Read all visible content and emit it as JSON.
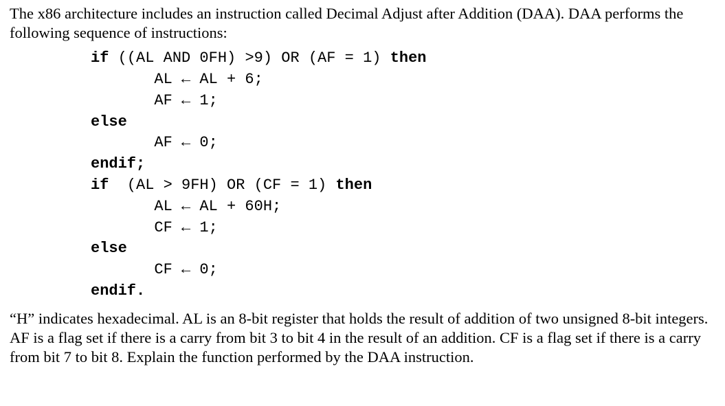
{
  "intro": "The x86 architecture includes an instruction called Decimal Adjust after Addition (DAA). DAA performs the following sequence of instructions:",
  "code": {
    "l1_kw": "if",
    "l1_txt": " ((AL AND 0FH) >9) OR (AF = 1) ",
    "l1_kw2": "then",
    "l2": "       AL ← AL + 6;",
    "l3": "       AF ← 1;",
    "l4_kw": "else",
    "l5": "       AF ← 0;",
    "l6_kw": "endif;",
    "l7_kw": "if",
    "l7_txt": "  (AL > 9FH) OR (CF = 1) ",
    "l7_kw2": "then",
    "l8": "       AL ← AL + 60H;",
    "l9": "       CF ← 1;",
    "l10_kw": "else",
    "l11": "       CF ← 0;",
    "l12_kw": "endif."
  },
  "outro": "“H” indicates hexadecimal. AL is an 8-bit register that holds the result of addition of two unsigned 8-bit integers. AF is a flag set if there is a carry from bit 3 to bit 4 in the result of an addition. CF is a flag set if there is a carry from bit 7 to bit 8. Explain the function performed by the DAA instruction."
}
